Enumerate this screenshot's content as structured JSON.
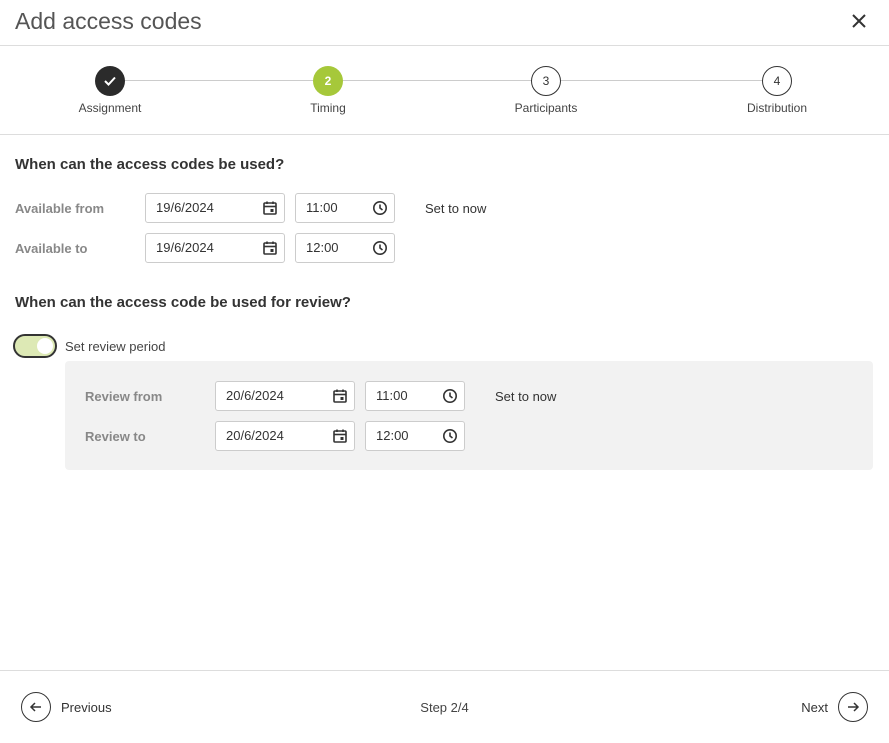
{
  "dialog": {
    "title": "Add access codes"
  },
  "stepper": {
    "steps": [
      {
        "number": "1",
        "label": "Assignment",
        "state": "done"
      },
      {
        "number": "2",
        "label": "Timing",
        "state": "active"
      },
      {
        "number": "3",
        "label": "Participants",
        "state": "todo"
      },
      {
        "number": "4",
        "label": "Distribution",
        "state": "todo"
      }
    ]
  },
  "availability": {
    "heading": "When can the access codes be used?",
    "from": {
      "label": "Available from",
      "date": "19/6/2024",
      "time": "11:00"
    },
    "to": {
      "label": "Available to",
      "date": "19/6/2024",
      "time": "12:00"
    },
    "set_now_label": "Set to now"
  },
  "review": {
    "heading": "When can the access code be used for review?",
    "toggle_label": "Set review period",
    "toggle_on": true,
    "from": {
      "label": "Review from",
      "date": "20/6/2024",
      "time": "11:00"
    },
    "to": {
      "label": "Review to",
      "date": "20/6/2024",
      "time": "12:00"
    },
    "set_now_label": "Set to now"
  },
  "footer": {
    "previous_label": "Previous",
    "next_label": "Next",
    "step_text": "Step 2/4"
  },
  "colors": {
    "accent": "#a6c83a",
    "done": "#2b2b2b",
    "toggle_bg": "#dde9b5"
  }
}
